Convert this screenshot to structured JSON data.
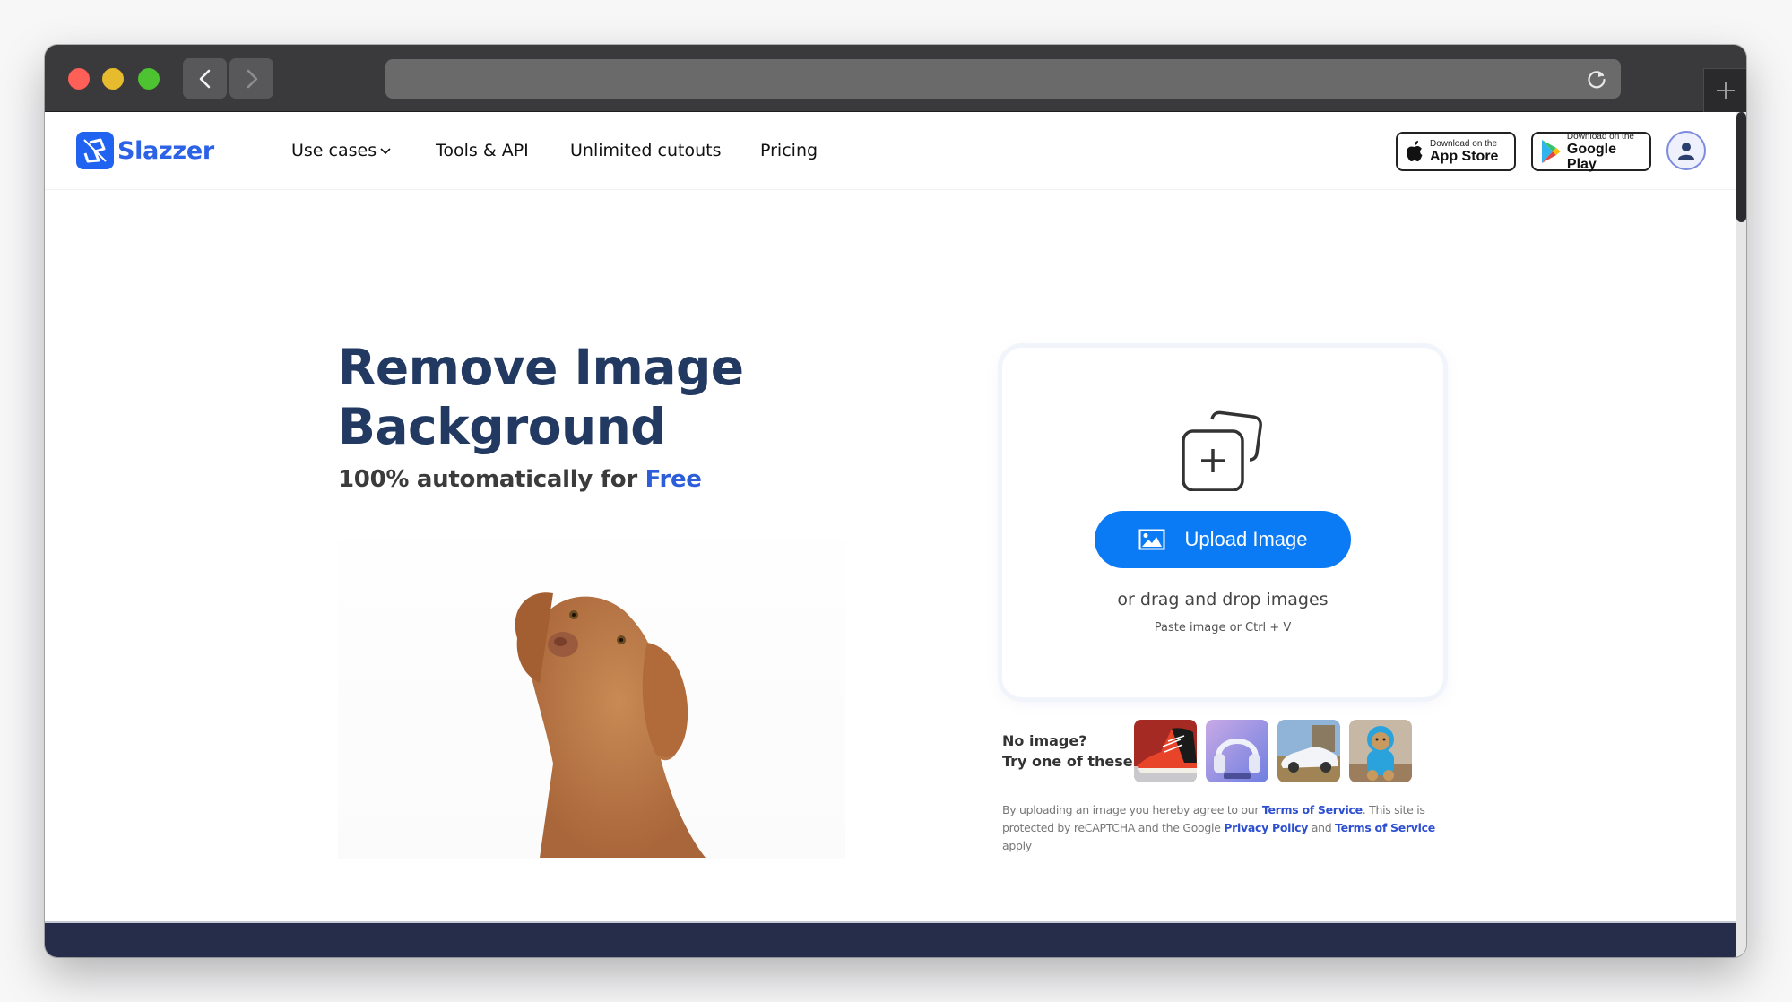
{
  "browser": {
    "back_label": "Back",
    "forward_label": "Forward",
    "address_value": "",
    "new_tab_label": "+"
  },
  "header": {
    "logo_text": "Slazzer",
    "nav": [
      {
        "label": "Use cases",
        "has_dropdown": true
      },
      {
        "label": "Tools & API"
      },
      {
        "label": "Unlimited cutouts"
      },
      {
        "label": "Pricing"
      }
    ],
    "app_store": {
      "small": "Download on the",
      "big": "App Store"
    },
    "google_play": {
      "small": "Download on the",
      "big": "Google Play"
    }
  },
  "hero": {
    "title_line1": "Remove Image",
    "title_line2": "Background",
    "subtitle_prefix": "100% automatically for ",
    "subtitle_highlight": "Free"
  },
  "upload": {
    "button_label": "Upload Image",
    "drag_text": "or drag and drop images",
    "paste_text": "Paste image or Ctrl + V"
  },
  "samples": {
    "label_line1": "No image?",
    "label_line2": "Try one of these:",
    "items": [
      {
        "name": "sneaker"
      },
      {
        "name": "headphones"
      },
      {
        "name": "car"
      },
      {
        "name": "teddy-bear"
      }
    ]
  },
  "legal": {
    "part1": "By uploading an image you hereby agree to our ",
    "link1": "Terms of Service",
    "part2": ". This site is protected by reCAPTCHA and the Google ",
    "link2": "Privacy Policy",
    "part3": " and ",
    "link3": "Terms of Service",
    "part4": " apply"
  },
  "colors": {
    "brand_blue": "#1f63f0",
    "upload_button": "#0a7af5",
    "title_navy": "#223a62",
    "footer_band": "#252d4a"
  }
}
